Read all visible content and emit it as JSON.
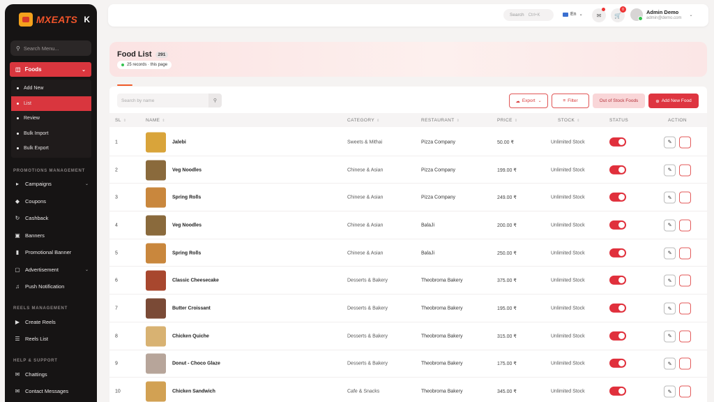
{
  "brand": {
    "name": "MXEATS",
    "collapse_icon": "K"
  },
  "sidebar": {
    "search_placeholder": "Search Menu...",
    "foods_label": "Foods",
    "foods_sub": [
      "Add New",
      "List",
      "Review",
      "Bulk Import",
      "Bulk Export"
    ],
    "sections": {
      "promotions": "PROMOTIONS MANAGEMENT",
      "reels": "REELS MANAGEMENT",
      "help": "HELP & SUPPORT"
    },
    "promotions_items": [
      "Campaigns",
      "Coupons",
      "Cashback",
      "Banners",
      "Promotional Banner",
      "Advertisement",
      "Push Notification"
    ],
    "reels_items": [
      "Create Reels",
      "Reels List"
    ],
    "help_items": [
      "Chattings",
      "Contact Messages"
    ]
  },
  "topbar": {
    "search_placeholder": "Search",
    "search_shortcut": "Ctrl+K",
    "language": "En",
    "cart_badge": "0",
    "user_name": "Admin Demo",
    "user_email": "admin@demo.com"
  },
  "page": {
    "title": "Food List",
    "total_count": "291",
    "records_info": "25 records · this page"
  },
  "toolbar": {
    "search_placeholder": "Search by name",
    "export_label": "Export",
    "filter_label": "Filter",
    "out_of_stock_label": "Out of Stock Foods",
    "add_label": "Add New Food"
  },
  "table": {
    "headers": {
      "sl": "SL",
      "name": "NAME",
      "category": "CATEGORY",
      "restaurant": "RESTAURANT",
      "price": "PRICE",
      "stock": "STOCK",
      "status": "STATUS",
      "action": "ACTION"
    },
    "rows": [
      {
        "sl": "1",
        "name": "Jalebi",
        "category": "Sweets & Mithai",
        "restaurant": "Pizza Company",
        "price": "50.00 ₹",
        "stock": "Unlimited Stock",
        "thumb_color": "#d9a43a"
      },
      {
        "sl": "2",
        "name": "Veg Noodles",
        "category": "Chinese & Asian",
        "restaurant": "Pizza Company",
        "price": "199.00 ₹",
        "stock": "Unlimited Stock",
        "thumb_color": "#8a6a3c"
      },
      {
        "sl": "3",
        "name": "Spring Rolls",
        "category": "Chinese & Asian",
        "restaurant": "Pizza Company",
        "price": "249.00 ₹",
        "stock": "Unlimited Stock",
        "thumb_color": "#c9873d"
      },
      {
        "sl": "4",
        "name": "Veg Noodles",
        "category": "Chinese & Asian",
        "restaurant": "BalaJi",
        "price": "200.00 ₹",
        "stock": "Unlimited Stock",
        "thumb_color": "#8a6a3c"
      },
      {
        "sl": "5",
        "name": "Spring Rolls",
        "category": "Chinese & Asian",
        "restaurant": "BalaJi",
        "price": "250.00 ₹",
        "stock": "Unlimited Stock",
        "thumb_color": "#c9873d"
      },
      {
        "sl": "6",
        "name": "Classic Cheesecake",
        "category": "Desserts & Bakery",
        "restaurant": "Theobroma Bakery",
        "price": "375.00 ₹",
        "stock": "Unlimited Stock",
        "thumb_color": "#a8472e"
      },
      {
        "sl": "7",
        "name": "Butter Croissant",
        "category": "Desserts & Bakery",
        "restaurant": "Theobroma Bakery",
        "price": "195.00 ₹",
        "stock": "Unlimited Stock",
        "thumb_color": "#7a4a36"
      },
      {
        "sl": "8",
        "name": "Chicken Quiche",
        "category": "Desserts & Bakery",
        "restaurant": "Theobroma Bakery",
        "price": "315.00 ₹",
        "stock": "Unlimited Stock",
        "thumb_color": "#d8b272"
      },
      {
        "sl": "9",
        "name": "Donut - Choco Glaze",
        "category": "Desserts & Bakery",
        "restaurant": "Theobroma Bakery",
        "price": "175.00 ₹",
        "stock": "Unlimited Stock",
        "thumb_color": "#b7a59a"
      },
      {
        "sl": "10",
        "name": "Chicken Sandwich",
        "category": "Cafe & Snacks",
        "restaurant": "Theobroma Bakery",
        "price": "345.00 ₹",
        "stock": "Unlimited Stock",
        "thumb_color": "#d2a153"
      }
    ]
  }
}
